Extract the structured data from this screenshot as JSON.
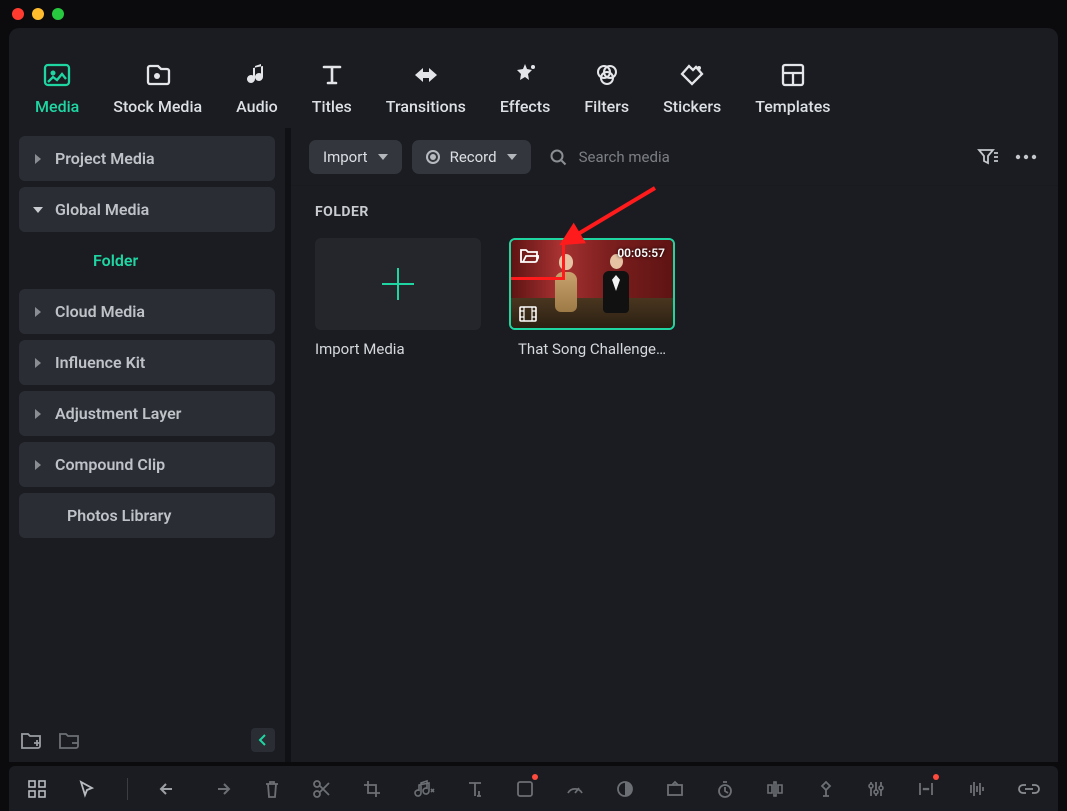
{
  "titlebar": {},
  "tabs": [
    {
      "id": "media",
      "label": "Media"
    },
    {
      "id": "stock",
      "label": "Stock Media"
    },
    {
      "id": "audio",
      "label": "Audio"
    },
    {
      "id": "titles",
      "label": "Titles"
    },
    {
      "id": "transitions",
      "label": "Transitions"
    },
    {
      "id": "effects",
      "label": "Effects"
    },
    {
      "id": "filters",
      "label": "Filters"
    },
    {
      "id": "stickers",
      "label": "Stickers"
    },
    {
      "id": "templates",
      "label": "Templates"
    }
  ],
  "active_tab": "media",
  "sidebar": {
    "items": [
      {
        "id": "project",
        "label": "Project Media",
        "expandable": true,
        "expanded": false
      },
      {
        "id": "global",
        "label": "Global Media",
        "expandable": true,
        "expanded": true,
        "children": [
          {
            "id": "folder",
            "label": "Folder"
          }
        ]
      },
      {
        "id": "cloud",
        "label": "Cloud Media",
        "expandable": true,
        "expanded": false
      },
      {
        "id": "influence",
        "label": "Influence Kit",
        "expandable": true,
        "expanded": false
      },
      {
        "id": "adjustment",
        "label": "Adjustment Layer",
        "expandable": true,
        "expanded": false
      },
      {
        "id": "compound",
        "label": "Compound Clip",
        "expandable": true,
        "expanded": false
      },
      {
        "id": "photos",
        "label": "Photos Library",
        "expandable": false,
        "expanded": false
      }
    ]
  },
  "toolbar": {
    "import_label": "Import",
    "record_label": "Record",
    "search_placeholder": "Search media"
  },
  "content": {
    "section_label": "FOLDER",
    "import_tile_label": "Import Media",
    "clip": {
      "name": "That Song Challenge…",
      "duration": "00:05:57"
    }
  },
  "accent_color": "#1fd6a3"
}
